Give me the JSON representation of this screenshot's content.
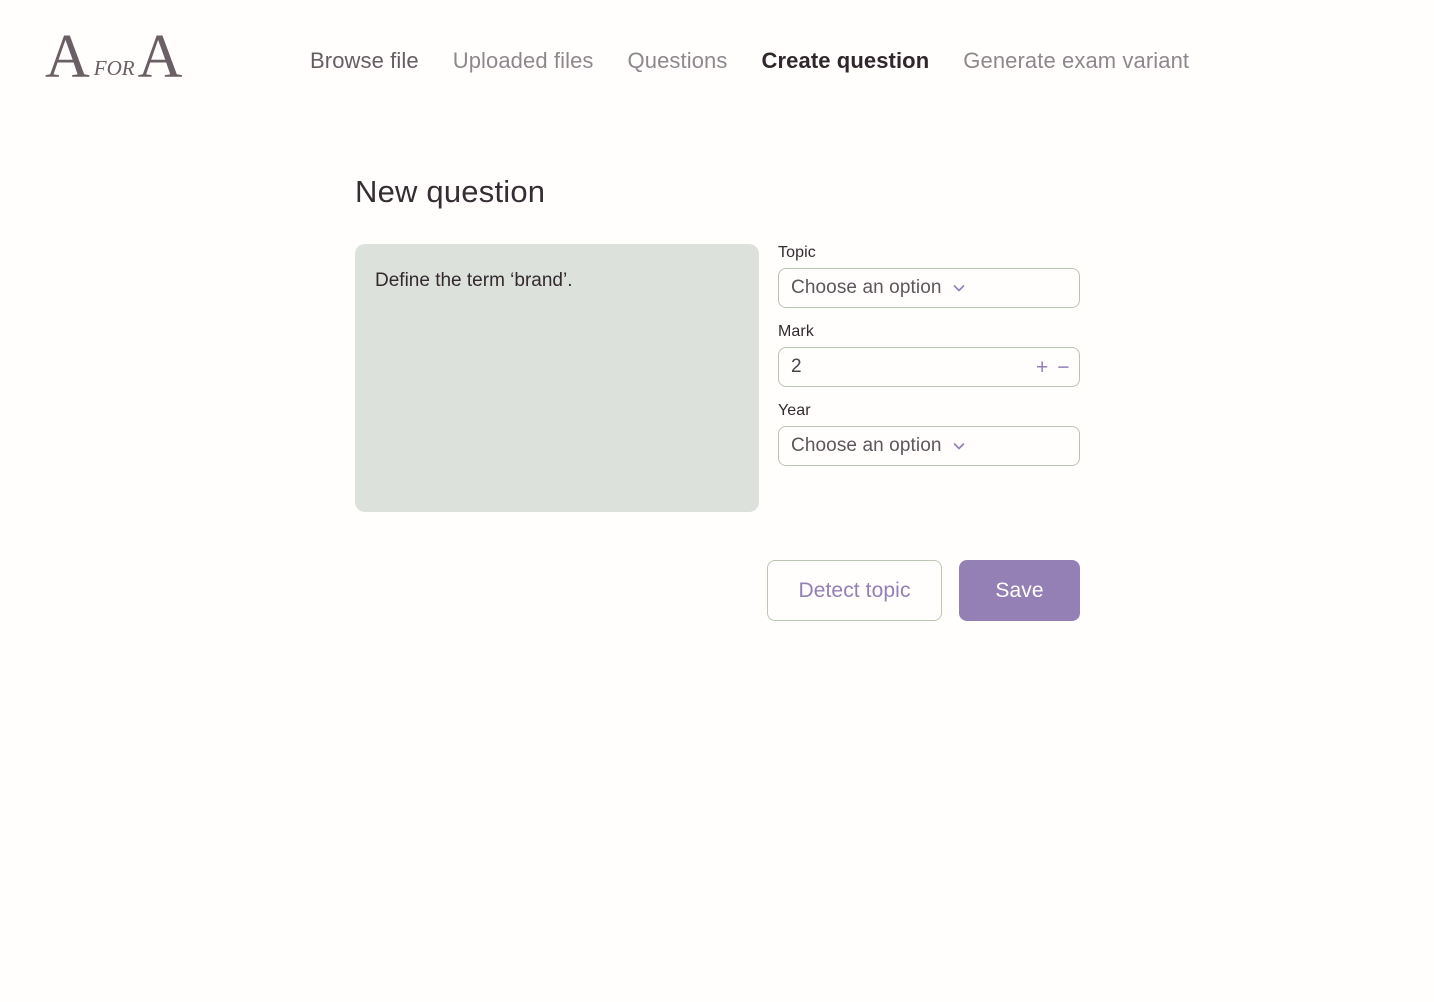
{
  "brand": {
    "letter_first": "A",
    "for": "for",
    "letter_last": "A",
    "color": "#6b5f66"
  },
  "nav": {
    "items": [
      {
        "label": "Browse file",
        "state": "dim-dark"
      },
      {
        "label": "Uploaded files",
        "state": "normal"
      },
      {
        "label": "Questions",
        "state": "normal"
      },
      {
        "label": "Create question",
        "state": "active"
      },
      {
        "label": "Generate exam variant",
        "state": "normal"
      }
    ]
  },
  "main": {
    "page_title": "New question",
    "question": {
      "value": "Define the term ‘brand’.",
      "placeholder": "",
      "background": "#dce1dc"
    },
    "fields": {
      "topic": {
        "label": "Topic",
        "value": "Choose an option",
        "icon": "chevron-down-icon"
      },
      "mark": {
        "label": "Mark",
        "value": "2",
        "increment_icon": "+",
        "decrement_icon": "−"
      },
      "year": {
        "label": "Year",
        "value": "Choose an option",
        "icon": "chevron-down-icon"
      }
    },
    "actions": {
      "detect_topic_label": "Detect topic",
      "save_label": "Save"
    }
  },
  "colors": {
    "accent_purple": "#9480b4",
    "field_border_green": "#b9c5b1",
    "textarea_green": "#dce1dc",
    "nav_inactive": "#8e878d",
    "nav_active": "#2f272c",
    "page_background": "#fffefd"
  }
}
